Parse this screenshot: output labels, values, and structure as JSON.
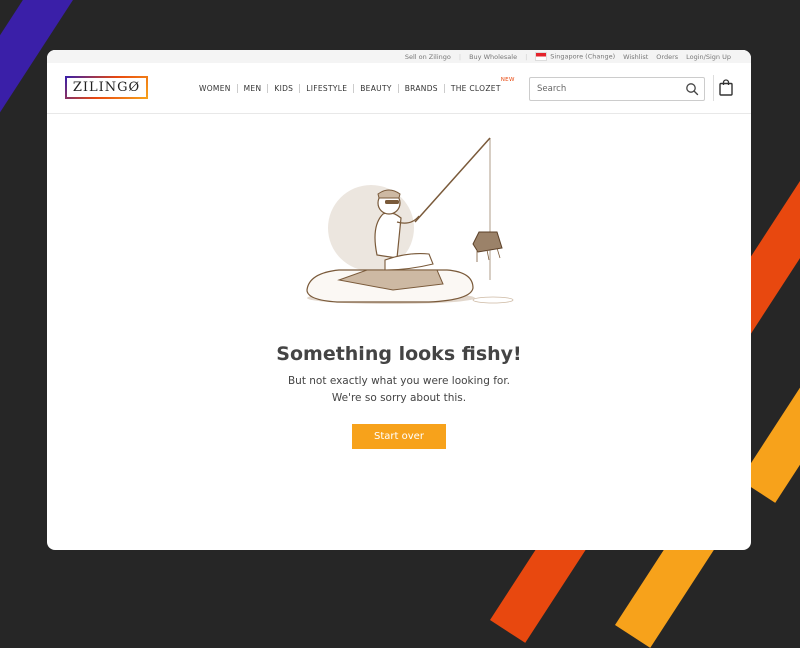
{
  "colors": {
    "background": "#262626",
    "accent_purple": "#3a1fa8",
    "accent_red": "#e8480f",
    "accent_orange": "#f7a21b",
    "illustration_brown": "#7a5a3a"
  },
  "topbar": {
    "sell": "Sell on Zilingo",
    "wholesale": "Buy Wholesale",
    "region": "Singapore (Change)",
    "wishlist": "Wishlist",
    "orders": "Orders",
    "login": "Login/Sign Up"
  },
  "header": {
    "logo": "ZILINGØ",
    "nav": [
      "WOMEN",
      "MEN",
      "KIDS",
      "LIFESTYLE",
      "BEAUTY",
      "BRANDS",
      "THE CLOZET"
    ],
    "new_badge": "NEW",
    "search_placeholder": "Search",
    "icons": {
      "search": "search-icon",
      "bag": "shopping-bag-icon",
      "flag": "singapore-flag-icon"
    }
  },
  "error": {
    "headline": "Something looks fishy!",
    "line1": "But not exactly what you were looking for.",
    "line2": "We're so sorry about this.",
    "button": "Start over"
  }
}
